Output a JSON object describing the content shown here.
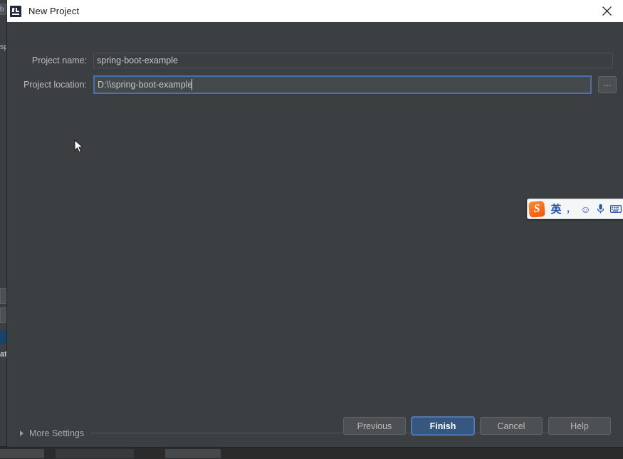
{
  "window": {
    "title": "New Project",
    "app_icon": "intellij-idea-icon",
    "close_label": "✕"
  },
  "form": {
    "fields": [
      {
        "label": "Project name:",
        "value": "spring-boot-example",
        "placeholder": "",
        "focused": false
      },
      {
        "label": "Project location:",
        "value": "D:\\\\spring-boot-example",
        "placeholder": "",
        "focused": true
      }
    ],
    "browse_button_label": "..."
  },
  "more_settings": {
    "label": "More Settings",
    "expander_icon": "chevron-right-icon",
    "expanded": false
  },
  "footer": {
    "buttons": [
      {
        "label": "Previous",
        "primary": false
      },
      {
        "label": "Finish",
        "primary": true
      },
      {
        "label": "Cancel",
        "primary": false
      },
      {
        "label": "Help",
        "primary": false
      }
    ]
  },
  "ime_toolbar": {
    "logo_text": "S",
    "logo_name": "sogou-logo",
    "items": [
      {
        "name": "language-mode-chinese",
        "glyph": "英"
      },
      {
        "name": "punctuation-toggle-icon",
        "glyph": "，"
      },
      {
        "name": "emoji-icon",
        "glyph": "☺"
      },
      {
        "name": "microphone-icon",
        "glyph": "🎤"
      },
      {
        "name": "keyboard-icon",
        "glyph": "⌨"
      }
    ]
  },
  "background": {
    "left_labels": [
      "b",
      "sp",
      "at"
    ],
    "colors": {
      "dialog_bg": "#3c3f41",
      "titlebar_bg": "#ffffff",
      "accent_blue": "#365880",
      "focus_blue": "#4b6eaf",
      "text": "#bbbbbb",
      "ime_orange": "#f4550f"
    }
  }
}
